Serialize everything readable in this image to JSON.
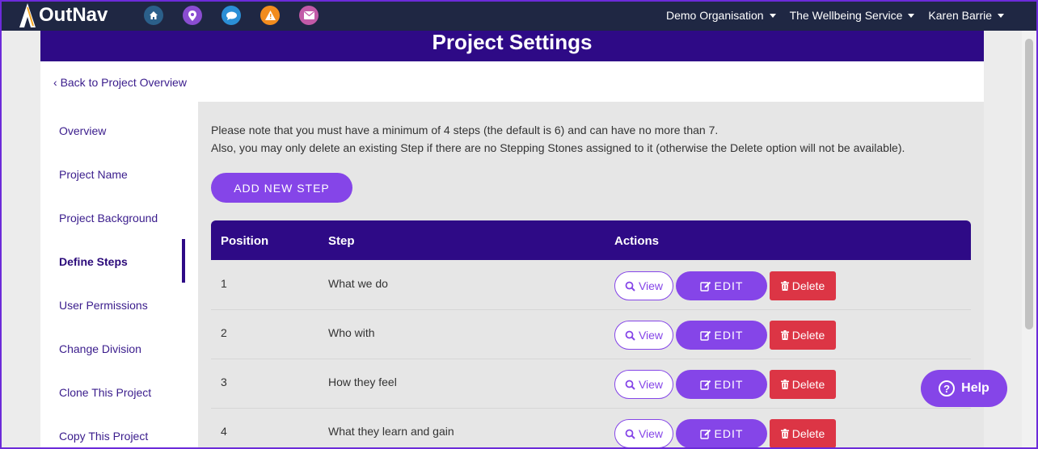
{
  "app": {
    "name": "OutNav"
  },
  "nav_icons": [
    {
      "name": "home-icon",
      "color": "#2b5f8a"
    },
    {
      "name": "location-pin-icon",
      "color": "#8a4dd1"
    },
    {
      "name": "chat-icon",
      "color": "#2b8fd6"
    },
    {
      "name": "warning-icon",
      "color": "#f28c1e"
    },
    {
      "name": "mail-icon",
      "color": "#c25aa8"
    }
  ],
  "nav_right": {
    "organisation": "Demo Organisation",
    "service": "The Wellbeing Service",
    "user": "Karen Barrie"
  },
  "page_title": "Project Settings",
  "back_link": "Back to Project Overview",
  "sidebar": {
    "items": [
      {
        "label": "Overview"
      },
      {
        "label": "Project Name"
      },
      {
        "label": "Project Background"
      },
      {
        "label": "Define Steps",
        "active": true
      },
      {
        "label": "User Permissions"
      },
      {
        "label": "Change Division"
      },
      {
        "label": "Clone This Project"
      },
      {
        "label": "Copy This Project"
      }
    ]
  },
  "main": {
    "note_1": "Please note that you must have a minimum of 4 steps (the default is 6) and can have no more than 7.",
    "note_2": "Also, you may only delete an existing Step if there are no Stepping Stones assigned to it (otherwise the Delete option will not be available).",
    "add_button": "ADD NEW STEP",
    "table": {
      "headers": {
        "position": "Position",
        "step": "Step",
        "actions": "Actions"
      },
      "rows": [
        {
          "position": "1",
          "step": "What we do"
        },
        {
          "position": "2",
          "step": "Who with"
        },
        {
          "position": "3",
          "step": "How they feel"
        },
        {
          "position": "4",
          "step": "What they learn and gain"
        }
      ],
      "actions": {
        "view": "View",
        "edit": "EDIT",
        "delete": "Delete"
      }
    }
  },
  "help_button": "Help",
  "colors": {
    "nav_bg": "#1f2743",
    "brand_purple": "#2e0a86",
    "accent_purple": "#8545e8",
    "danger": "#dc3545"
  }
}
